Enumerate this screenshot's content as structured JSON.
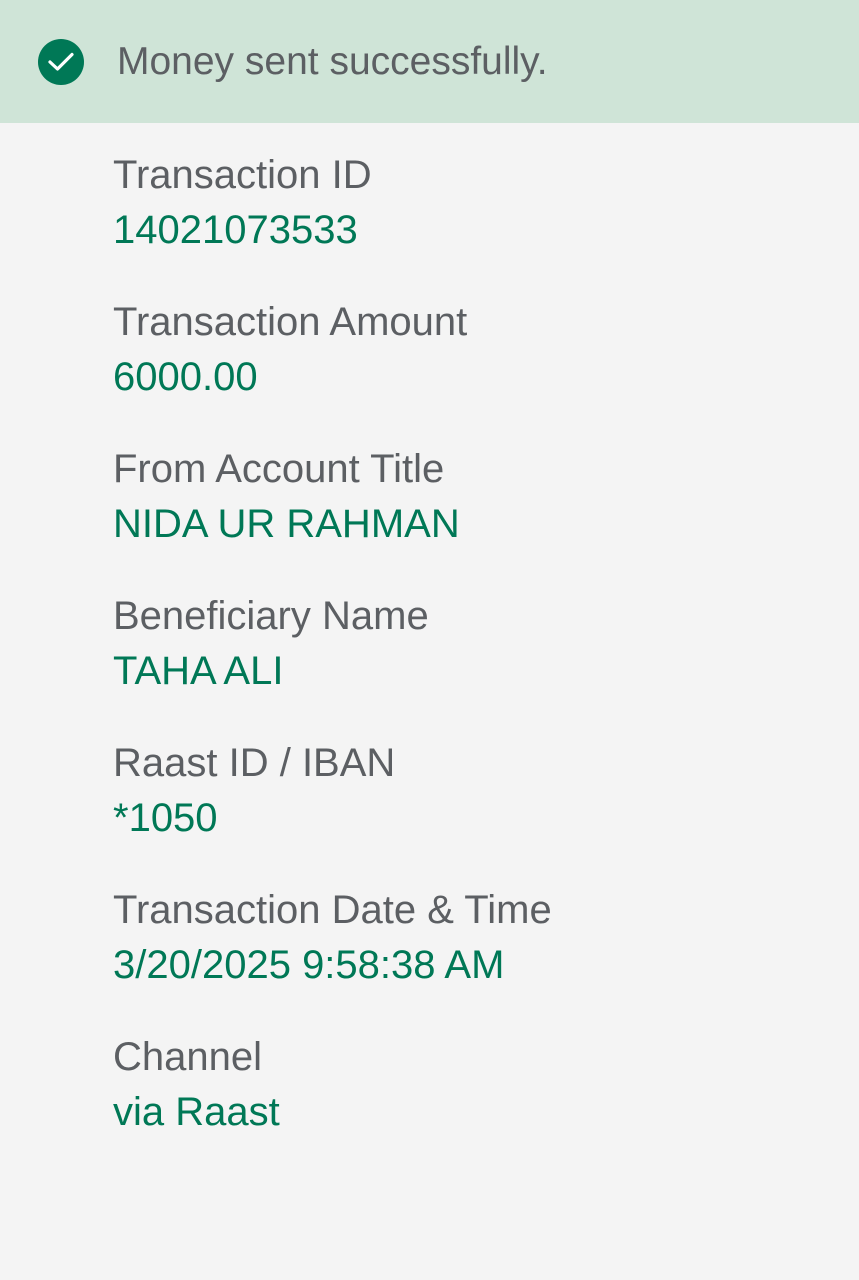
{
  "banner": {
    "icon": "check-circle-icon",
    "message": "Money sent successfully.",
    "icon_color": "#007856",
    "background": "#cfe4d7"
  },
  "details": [
    {
      "label": "Transaction ID",
      "value": "14021073533"
    },
    {
      "label": "Transaction Amount",
      "value": "6000.00"
    },
    {
      "label": "From Account Title",
      "value": "NIDA UR RAHMAN"
    },
    {
      "label": "Beneficiary Name",
      "value": "TAHA ALI"
    },
    {
      "label": "Raast ID / IBAN",
      "value": "*1050"
    },
    {
      "label": "Transaction Date & Time",
      "value": "3/20/2025 9:58:38 AM"
    },
    {
      "label": "Channel",
      "value": "via Raast"
    }
  ],
  "colors": {
    "label": "#5c5f63",
    "value": "#007856",
    "page_background": "#f4f4f4"
  }
}
